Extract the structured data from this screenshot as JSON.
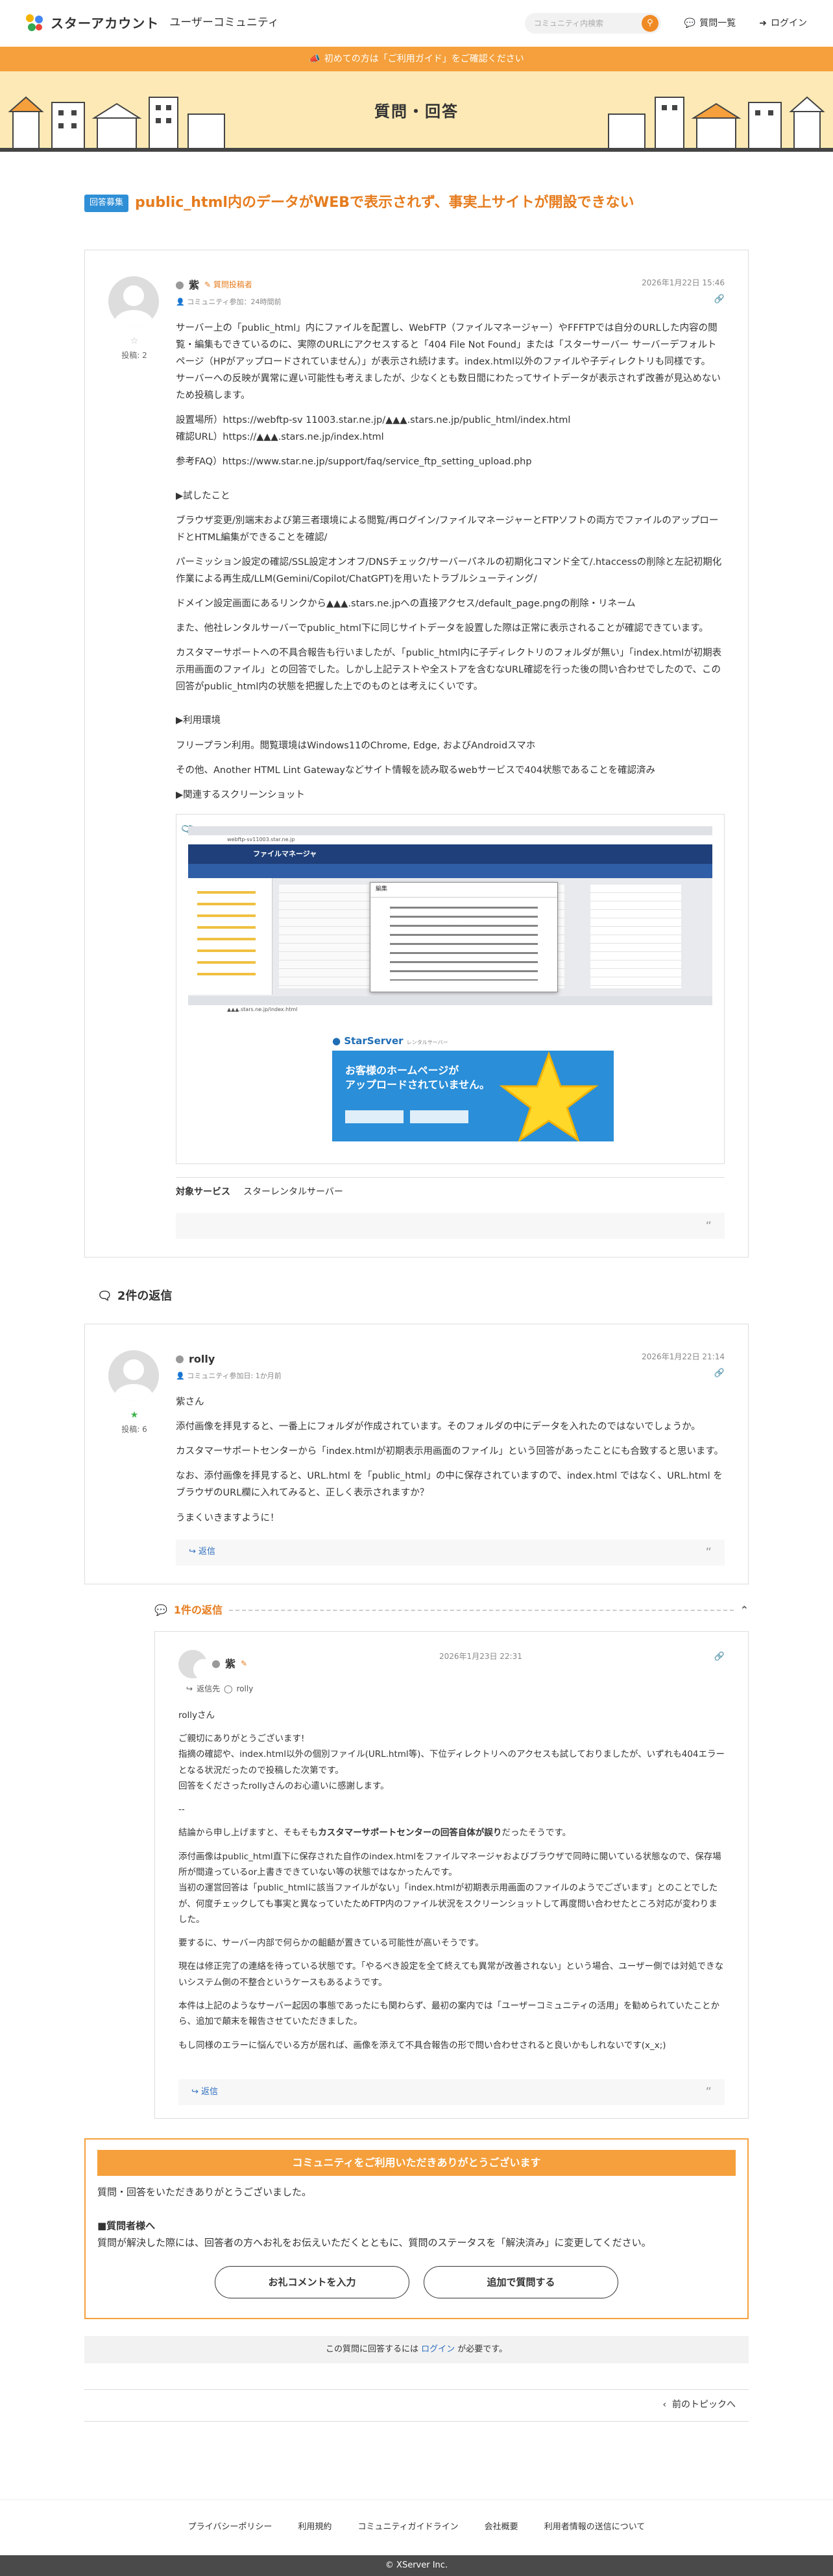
{
  "header": {
    "logo_text": "スターアカウント",
    "logo_sub": "ユーザーコミュニティ",
    "search_placeholder": "コミュニティ内検索",
    "nav_questions": "質問一覧",
    "nav_login": "ログイン"
  },
  "notice": "初めての方は「ご利用ガイド」をご確認ください",
  "hero_title": "質問・回答",
  "question": {
    "badge": "回答募集",
    "title": "public_html内のデータがWEBで表示されず、事実上サイトが開設できない",
    "user": "紫",
    "role": "質問投稿者",
    "join": "コミュニティ参加：24時間前",
    "date": "2026年1月22日 15:46",
    "post_count": "投稿: 2",
    "p1": "サーバー上の「public_html」内にファイルを配置し、WebFTP（ファイルマネージャー）やFFFTPでは自分のURLした内容の閲覧・編集もできているのに、実際のURLにアクセスすると「404 File Not Found」または「スターサーバー サーバーデフォルトページ（HPがアップロードされていません）」が表示され続けます。index.html以外のファイルや子ディレクトリも同様です。",
    "p2": "サーバーへの反映が異常に遅い可能性も考えましたが、少なくとも数日間にわたってサイトデータが表示されず改善が見込めないため投稿します。",
    "p3": "設置場所）https://webftp-sv 11003.star.ne.jp/▲▲▲.stars.ne.jp/public_html/index.html",
    "p4": "確認URL）https://▲▲▲.stars.ne.jp/index.html",
    "p5": "参考FAQ）https://www.star.ne.jp/support/faq/service_ftp_setting_upload.php",
    "h_tried": "▶試したこと",
    "t1": "ブラウザ変更/別端末および第三者環境による閲覧/再ログイン/ファイルマネージャーとFTPソフトの両方でファイルのアップロードとHTML編集ができることを確認/",
    "t2": "パーミッション設定の確認/SSL設定オンオフ/DNSチェック/サーバーパネルの初期化コマンド全て/.htaccessの削除と左記初期化作業による再生成/LLM(Gemini/Copilot/ChatGPT)を用いたトラブルシューティング/",
    "t3": "ドメイン設定画面にあるリンクから▲▲▲.stars.ne.jpへの直接アクセス/default_page.pngの削除・リネーム",
    "t4": "また、他社レンタルサーバーでpublic_html下に同じサイトデータを設置した際は正常に表示されることが確認できています。",
    "t5": "カスタマーサポートへの不具合報告も行いましたが、「public_html内に子ディレクトリのフォルダが無い」「index.htmlが初期表示用画面のファイル」との回答でした。しかし上記テストや全ストアを含むなURL確認を行った後の問い合わせでしたので、この回答がpublic_html内の状態を把握した上でのものとは考えにくいです。",
    "h_env": "▶利用環境",
    "e1": "フリープラン利用。閲覧環境はWindows11のChrome, Edge, およびAndroidスマホ",
    "e2": "その他、Another HTML Lint Gatewayなどサイト情報を読み取るwebサービスで404状態であることを確認済み",
    "h_ss": "▶関連するスクリーンショット",
    "services_label": "対象サービス",
    "services_value": "スターレンタルサーバー"
  },
  "screenshot": {
    "tab_url": "webftp-sv11003.star.ne.jp",
    "fm_title": "ファイルマネージャ",
    "dialog_title": "編集",
    "url2": "▲▲▲.stars.ne.jp/index.html",
    "brand": "StarServer",
    "brand_sub": "レンタルサーバー",
    "message_l1": "お客様のホームページが",
    "message_l2": "アップロードされていません。"
  },
  "replies_heading": "2件の返信",
  "reply1": {
    "user": "rolly",
    "join": "コミュニティ参加日: 1か月前",
    "date": "2026年1月22日 21:14",
    "post_count": "投稿: 6",
    "p1": "紫さん",
    "p2": "添付画像を拝見すると、一番上にフォルダが作成されています。そのフォルダの中にデータを入れたのではないでしょうか。",
    "p3": "カスタマーサポートセンターから「index.htmlが初期表示用画面のファイル」という回答があったことにも合致すると思います。",
    "p4": "なお、添付画像を拝見すると、URL.html を「public_html」の中に保存されていますので、index.html ではなく、URL.html をブラウザのURL欄に入れてみると、正しく表示されますか？",
    "p5": "うまくいきますように！",
    "reply_label": "返信"
  },
  "sub_reply_heading": "1件の返信",
  "reply2": {
    "user": "紫",
    "date": "2026年1月23日 22:31",
    "reply_to_label": "返信先",
    "reply_to_user": "rolly",
    "p1": "rollyさん",
    "p2": "ご親切にありがとうございます!",
    "p3": "指摘の確認や、index.html以外の個別ファイル(URL.html等)、下位ディレクトリへのアクセスも試しておりましたが、いずれも404エラーとなる状況だったので投稿した次第です。",
    "p4": "回答をくださったrollyさんのお心遣いに感謝します。",
    "p5": "--",
    "p6a": "結論から申し上げますと、そもそも",
    "p6b": "カスタマーサポートセンターの回答自体が誤り",
    "p6c": "だったそうです。",
    "p7": "添付画像はpublic_html直下に保存された自作のindex.htmlをファイルマネージャおよびブラウザで同時に開いている状態なので、保存場所が間違っているor上書きできていない等の状態ではなかったんです。",
    "p8": "当初の運営回答は「public_htmlに該当ファイルがない」「index.htmlが初期表示用画面のファイルのようでございます」とのことでしたが、何度チェックしても事実と異なっていたためFTP内のファイル状況をスクリーンショットして再度問い合わせたところ対応が変わりました。",
    "p9": "要するに、サーバー内部で何らかの齟齬が置きている可能性が高いそうです。",
    "p10": "現在は修正完了の連絡を待っている状態です。「やるべき設定を全て終えても異常が改善されない」という場合、ユーザー側では対処できないシステム側の不整合というケースもあるようです。",
    "p11": "本件は上記のようなサーバー起因の事態であったにも関わらず、最初の案内では「ユーザーコミュニティの活用」を勧められていたことから、追加で顛末を報告させていただきました。",
    "p12": "もし同様のエラーに悩んでいる方が居れば、画像を添えて不具合報告の形で問い合わせされると良いかもしれないです(x_x;)",
    "reply_label": "返信"
  },
  "thanks": {
    "head": "コミュニティをご利用いただきありがとうございます",
    "p1": "質問・回答をいただきありがとうございました。",
    "h2": "■質問者様へ",
    "p2": "質問が解決した際には、回答者の方へお礼をお伝えいただくとともに、質問のステータスを「解決済み」に変更してください。",
    "btn1": "お礼コメントを入力",
    "btn2": "追加で質問する"
  },
  "login_note_pre": "この質問に回答するには",
  "login_note_link": "ログイン",
  "login_note_post": "が必要です。",
  "prev_topic": "前のトピックへ",
  "footer": {
    "links": [
      "プライバシーポリシー",
      "利用規約",
      "コミュニティガイドライン",
      "会社概要",
      "利用者情報の送信について"
    ],
    "copyright": "© XServer Inc."
  },
  "colors": {
    "accent": "#f08a24",
    "banner": "#f5a03c",
    "hero_bg": "#fde9b5",
    "link": "#2f6fbf",
    "badge": "#2f8fd6"
  }
}
